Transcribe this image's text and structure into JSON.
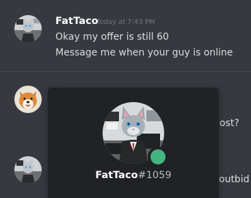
{
  "message": {
    "author": "FatTaco",
    "timestamp": "Today at 7:43 PM",
    "lines": [
      "Okay my offer is still 60",
      "Message me when your guy is online"
    ]
  },
  "partial_messages": [
    "ost?",
    "outbid"
  ],
  "popout": {
    "username": "FatTaco",
    "discriminator": "#1059",
    "status": "online"
  },
  "colors": {
    "background": "#36393f",
    "popout_background": "#202225",
    "online_status": "#43b581",
    "timestamp": "#72767d"
  }
}
